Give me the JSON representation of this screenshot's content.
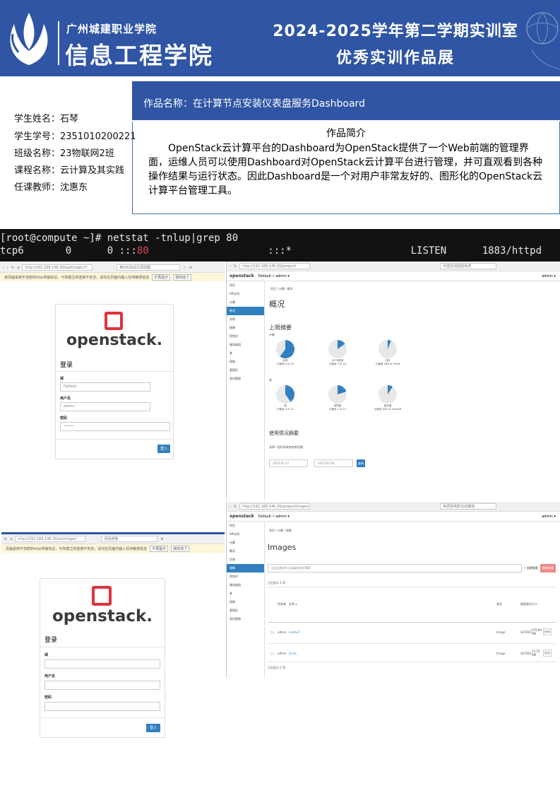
{
  "banner": {
    "school": "广州城建职业学院",
    "college": "信息工程学院",
    "title_line1": "2024-2025学年第二学期实训室",
    "title_line2": "优秀实训作品展"
  },
  "student": {
    "name_label": "学生姓名：",
    "name": "石琴",
    "id_label": "学生学号：",
    "id": "2351010200221",
    "class_label": "班级名称：",
    "class": "23物联网2班",
    "course_label": "课程名称：",
    "course": "云计算及其实践",
    "teacher_label": "任课教师：",
    "teacher": "沈惠东"
  },
  "work": {
    "title": "作品名称：在计算节点安装仪表盘服务Dashboard",
    "intro_heading": "作品简介",
    "intro_text": "OpenStack云计算平台的Dashboard为OpenStack提供了一个Web前端的管理界面，运维人员可以使用Dashboard对OpenStack云计算平台进行管理，并可直观看到各种操作结果与运行状态。因此Dashboard是一个对用户非常友好的、图形化的OpenStack云计算平台管理工具。"
  },
  "terminal": {
    "line1": "[root@compute ~]# netstat -tnlup|grep 80",
    "line2_a": "tcp6       0      0 :::",
    "line2_port": "80",
    "line2_b": "                    :::*                    LISTEN      1883/httpd"
  },
  "login1": {
    "url": "http://192.168.146.20/auth/login/?r",
    "search": "用OS28设计添加图",
    "warning": "该页面采用不加密的http传输协议，与你建立的连接不安全，请勿在页面内输入任何敏感信息",
    "warn_btn1": "不再提示",
    "warn_btn2": "我知道了",
    "logo": "openstack.",
    "heading": "登录",
    "domain_label": "域",
    "domain_value": "Default",
    "user_label": "用户名",
    "user_value": "admin",
    "pass_label": "密码",
    "pass_value": "•••••",
    "submit": "登入"
  },
  "login2": {
    "url": "http://192.168.146.20/auth/login/",
    "search": "添加搜索",
    "warning": "页面采用不加密的http传输协议，与你建立的连接不安全，请勿在页面内输入任何敏感信息",
    "warn_btn1": "不再提示",
    "warn_btn2": "我知道了",
    "logo": "openstack.",
    "heading": "登录",
    "domain_label": "域",
    "user_label": "用户名",
    "pass_label": "密码",
    "submit": "登入"
  },
  "overview": {
    "url": "http://192.168.146.20/project/",
    "search": "中国在线医院免费",
    "brand": "openstack",
    "project": "Default • admin ▾",
    "user": "admin ▾",
    "breadcrumb": "项目 / 计算 / 概况",
    "title": "概况",
    "limit_title": "上限摘要",
    "compute_label": "计算",
    "volume_label": "卷",
    "usage_title": "使用情况摘要",
    "usage_sub": "选择一段时间来查询其用量：",
    "date_from": "2025-05-27",
    "date_to": "2025-05-28",
    "query_btn": "查询",
    "sidebar": [
      "项目",
      "API访问",
      "计算",
      "概况",
      "实例",
      "镜像",
      "密钥对",
      "服务器组",
      "卷",
      "网络",
      "管理员",
      "身份管理"
    ],
    "pies": [
      {
        "name": "实例",
        "used": "已使用 6 of 10",
        "fraction": 0.6
      },
      {
        "name": "VCPU数量",
        "used": "已使用 3 of 20",
        "fraction": 0.15
      },
      {
        "name": "内存",
        "used": "已使用 3GB of 50GB",
        "fraction": 0.06
      },
      {
        "name": "卷",
        "used": "已使用 4 of 10",
        "fraction": 0.4
      },
      {
        "name": "卷快照",
        "used": "已使用 2 of 10",
        "fraction": 0.2
      },
      {
        "name": "卷存储",
        "used": "已使用 9GB of 1000GB",
        "fraction": 0.09
      }
    ]
  },
  "images": {
    "url": "http://192.168.146.20/project/images",
    "search": "免费看电影在线播放",
    "brand": "openstack",
    "project": "Default • admin ▾",
    "user": "admin ▾",
    "breadcrumb": "项目 / 计算 / 镜像",
    "title": "Images",
    "filter_placeholder": "点击这里进行过滤或者全文搜索",
    "create_btn": "+ 创建镜像",
    "delete_btn": "删除镜像",
    "count": "正在显示 2 项",
    "col_owner": "所有者",
    "col_name": "名称 ▴",
    "col_type": "类型",
    "col_format": "磁盘格式",
    "col_size": "大小",
    "rows": [
      {
        "owner": "admin",
        "name": "centos7",
        "type": "Image",
        "format": "QCOW2",
        "size": "670.69 MB",
        "action": "启动"
      },
      {
        "owner": "admin",
        "name": "cirros",
        "type": "Image",
        "format": "QCOW2",
        "size": "15.55 MB",
        "action": "启动"
      }
    ],
    "sidebar": [
      "项目",
      "API访问",
      "计算",
      "概况",
      "实例",
      "镜像",
      "密钥对",
      "服务器组",
      "卷",
      "网络",
      "管理员",
      "身份管理"
    ]
  },
  "colors": {
    "brand_blue": "#2f55a4",
    "openstack_red": "#e0323d",
    "button_blue": "#3380c0"
  }
}
